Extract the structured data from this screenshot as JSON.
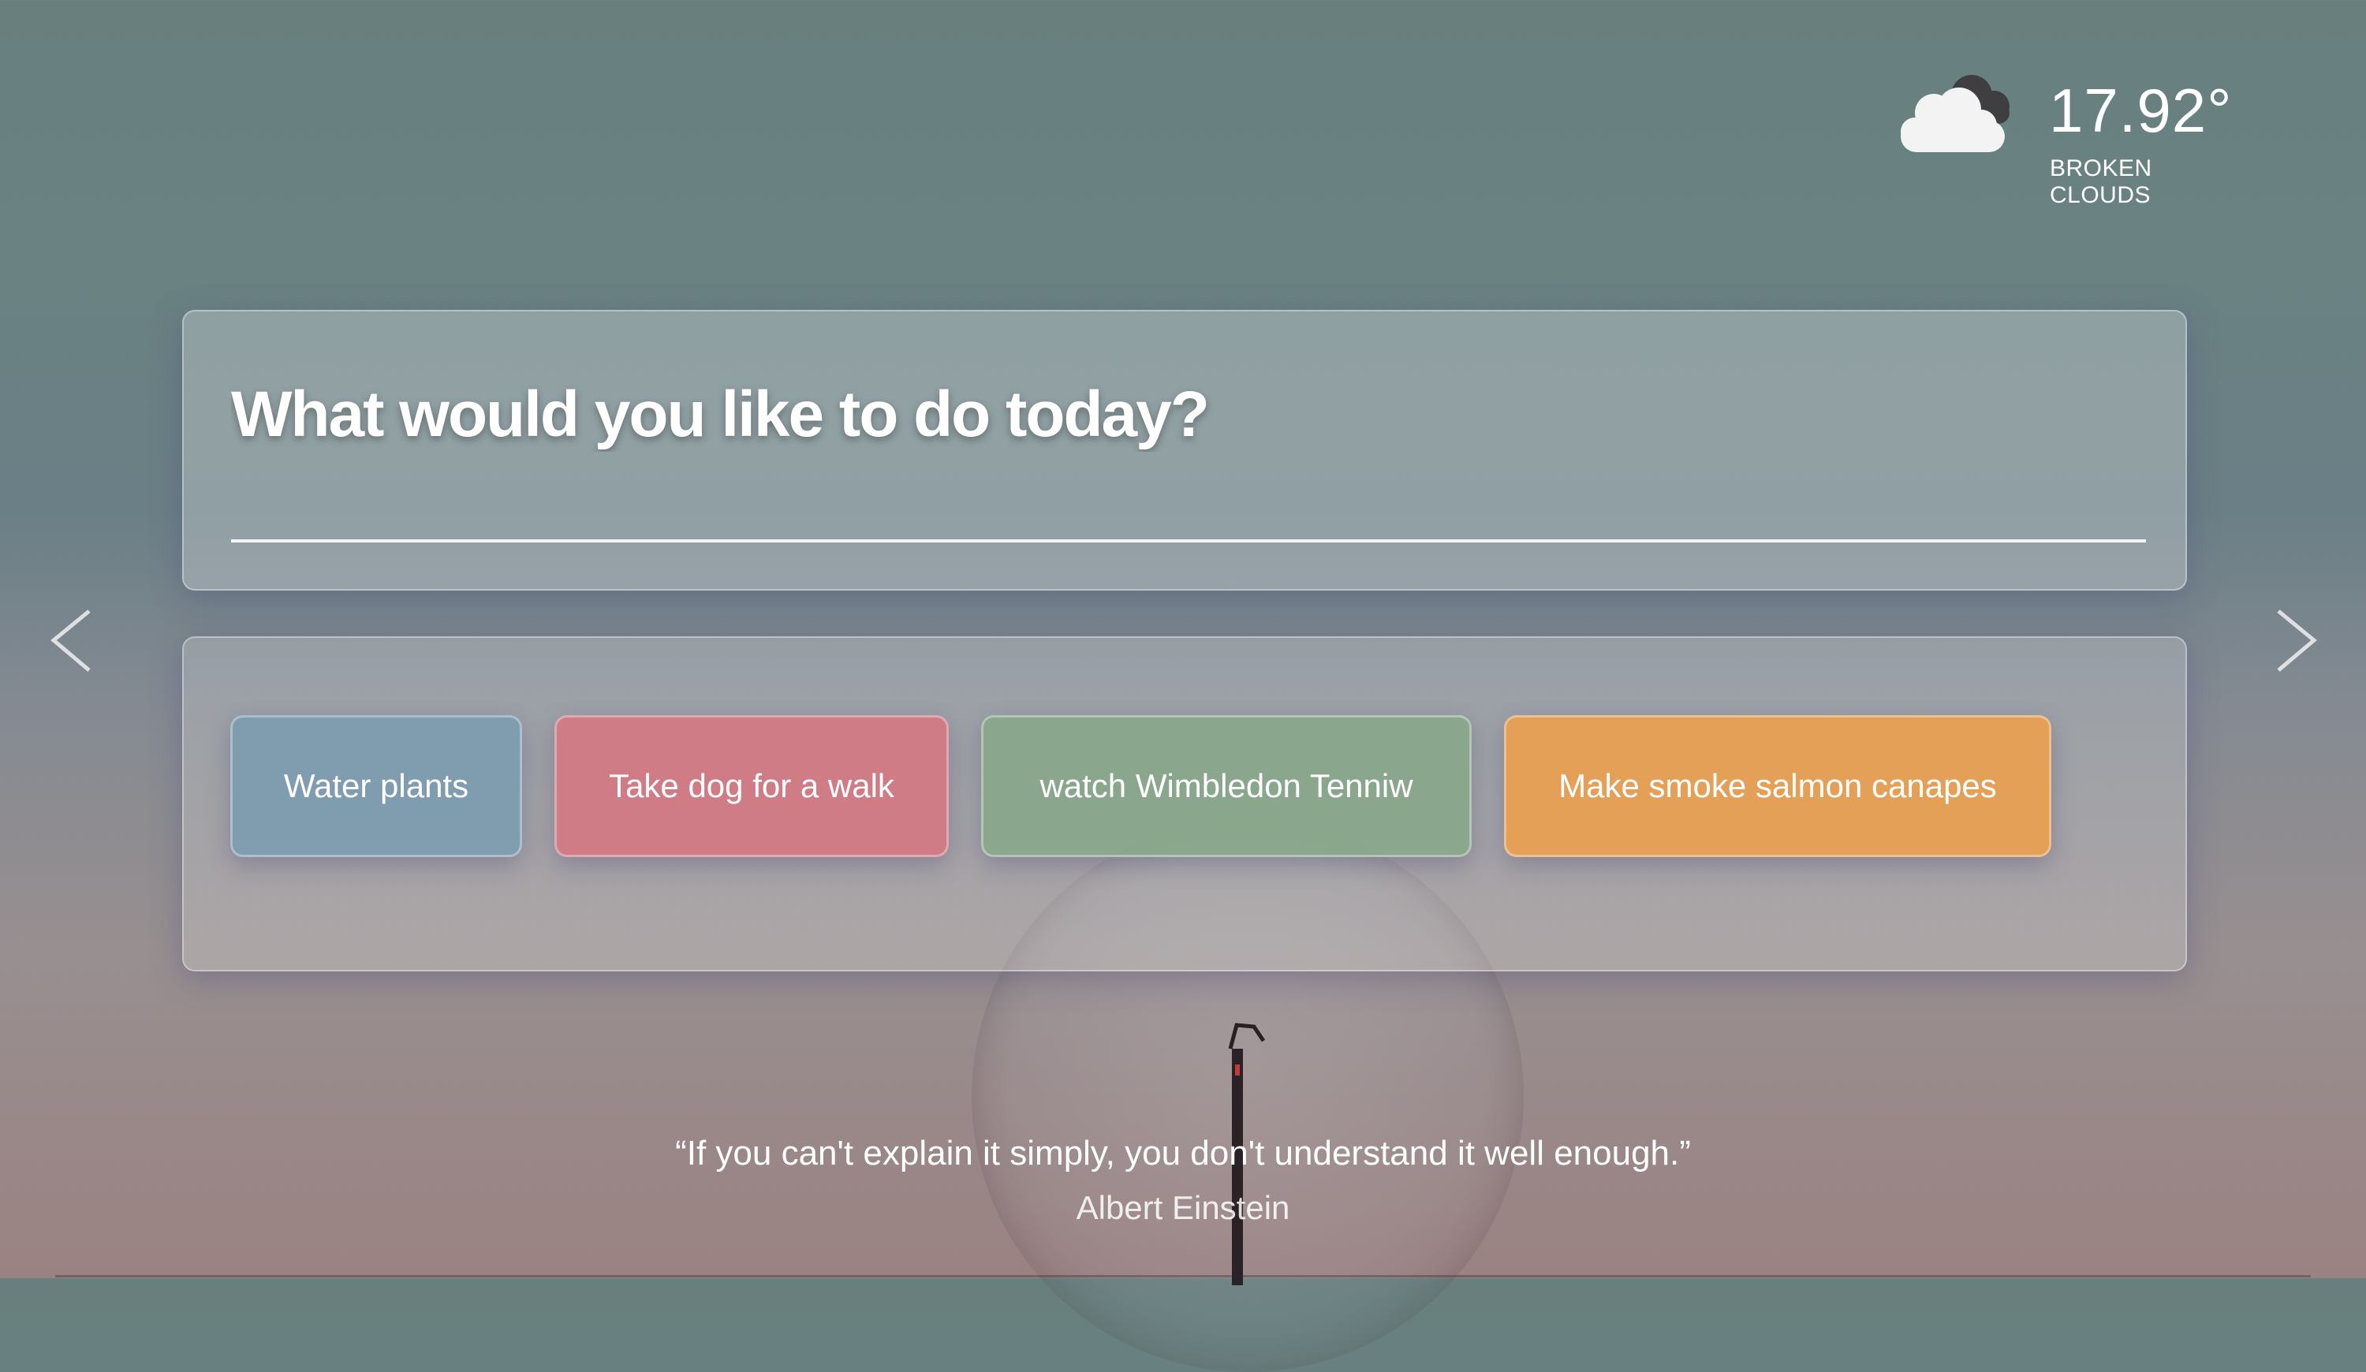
{
  "weather": {
    "icon": "broken-clouds-icon",
    "temperature": "17.92°",
    "condition": "BROKEN CLOUDS"
  },
  "todo": {
    "prompt": "What would you like to do today?"
  },
  "tasks": [
    {
      "label": "Water plants",
      "color": "#7a9cb2"
    },
    {
      "label": "Take dog for a walk",
      "color": "#d67682"
    },
    {
      "label": "watch Wimbledon Tenniw",
      "color": "#86a888"
    },
    {
      "label": "Make smoke salmon canapes",
      "color": "#eca050"
    }
  ],
  "navigation": {
    "prev_icon": "chevron-left-icon",
    "next_icon": "chevron-right-icon"
  },
  "quote": {
    "text": "“If you can't explain it simply, you don't understand it well enough.”",
    "author": "Albert Einstein"
  }
}
